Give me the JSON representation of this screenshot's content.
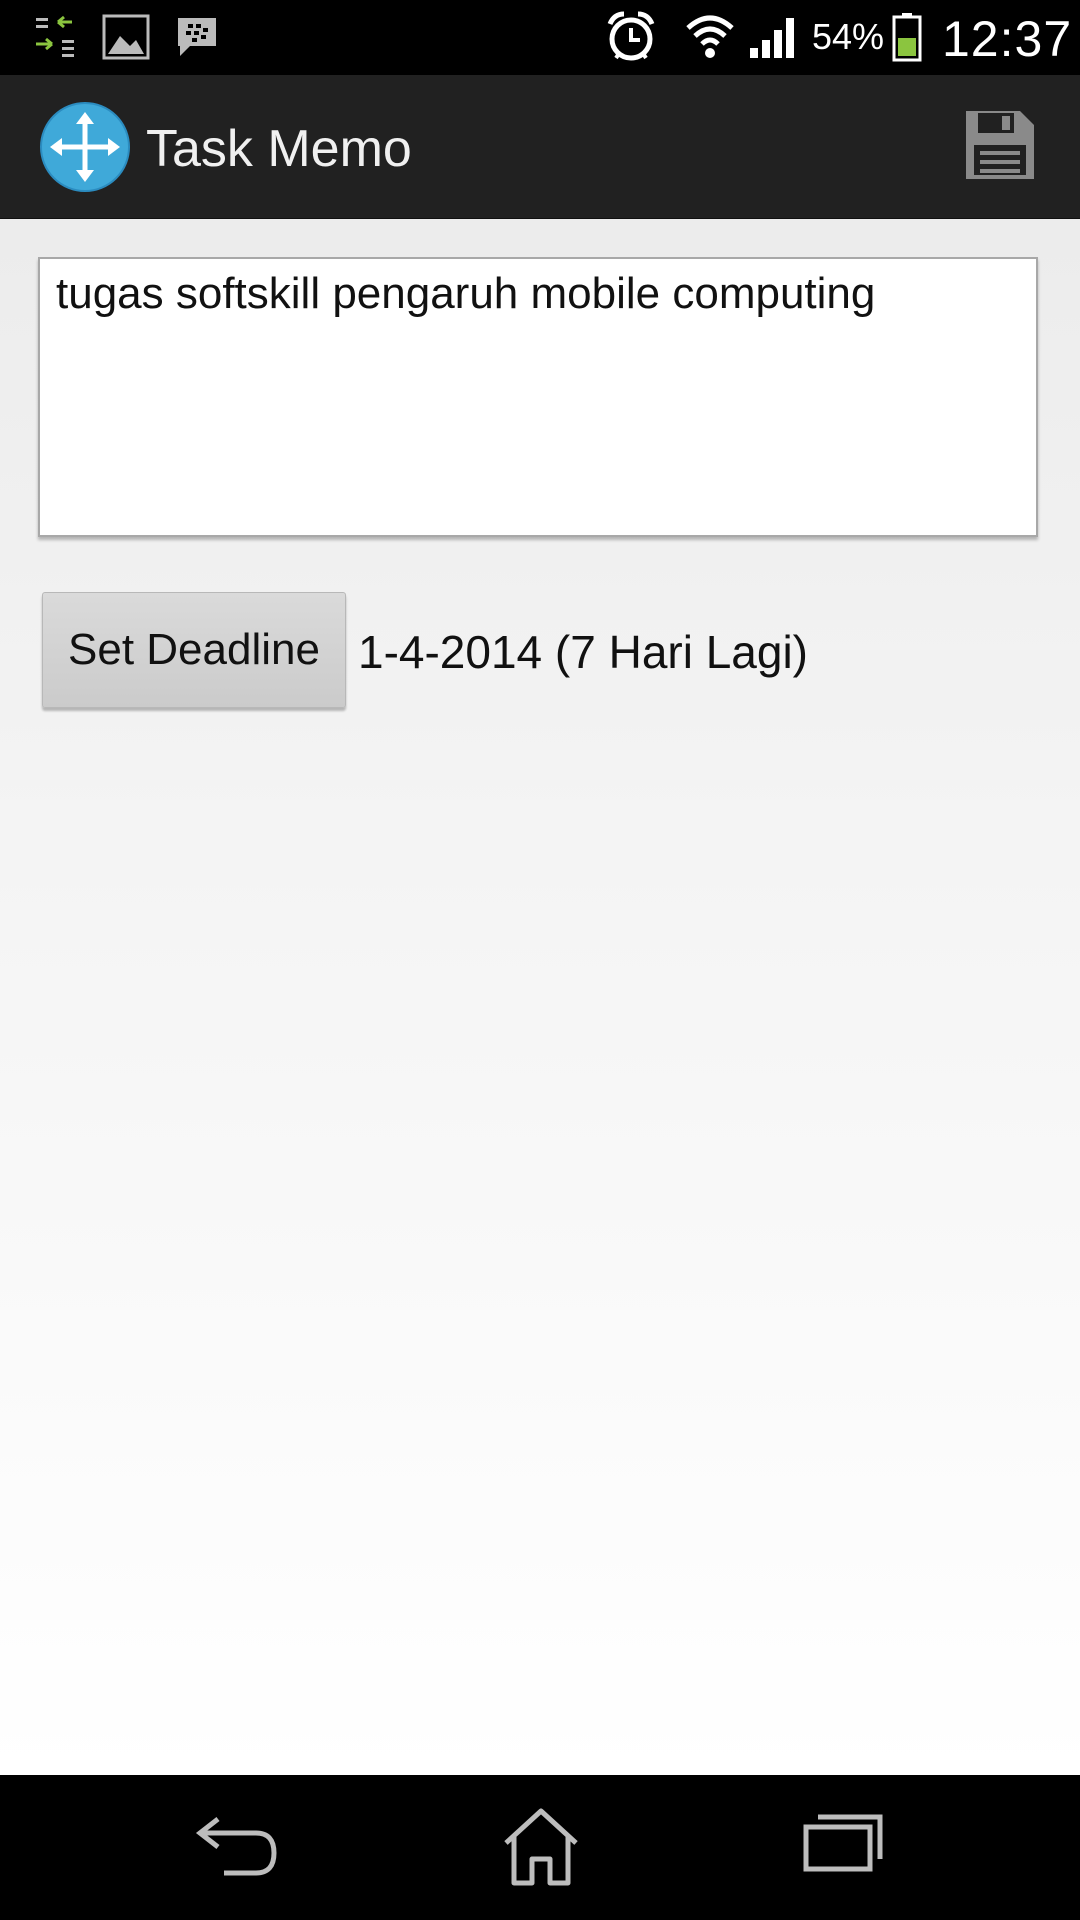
{
  "status_bar": {
    "icons": [
      "transfer-icon",
      "gallery-icon",
      "bbm-icon",
      "alarm-icon",
      "wifi-icon",
      "signal-icon",
      "battery-icon"
    ],
    "battery_percent": "54%",
    "battery_level": 0.54,
    "time": "12:37"
  },
  "action_bar": {
    "title": "Task Memo",
    "app_icon": "move-arrows-icon",
    "save_icon": "save-icon"
  },
  "memo": {
    "text": "tugas softskill pengaruh mobile computing"
  },
  "deadline": {
    "button_label": "Set Deadline",
    "value": "1-4-2014 (7 Hari Lagi)"
  },
  "nav_bar": {
    "icons": [
      "back-icon",
      "home-icon",
      "recent-apps-icon"
    ]
  },
  "colors": {
    "accent": "#3fa9d9",
    "battery_fill": "#8bc53f",
    "transfer_green": "#8bc53f"
  }
}
